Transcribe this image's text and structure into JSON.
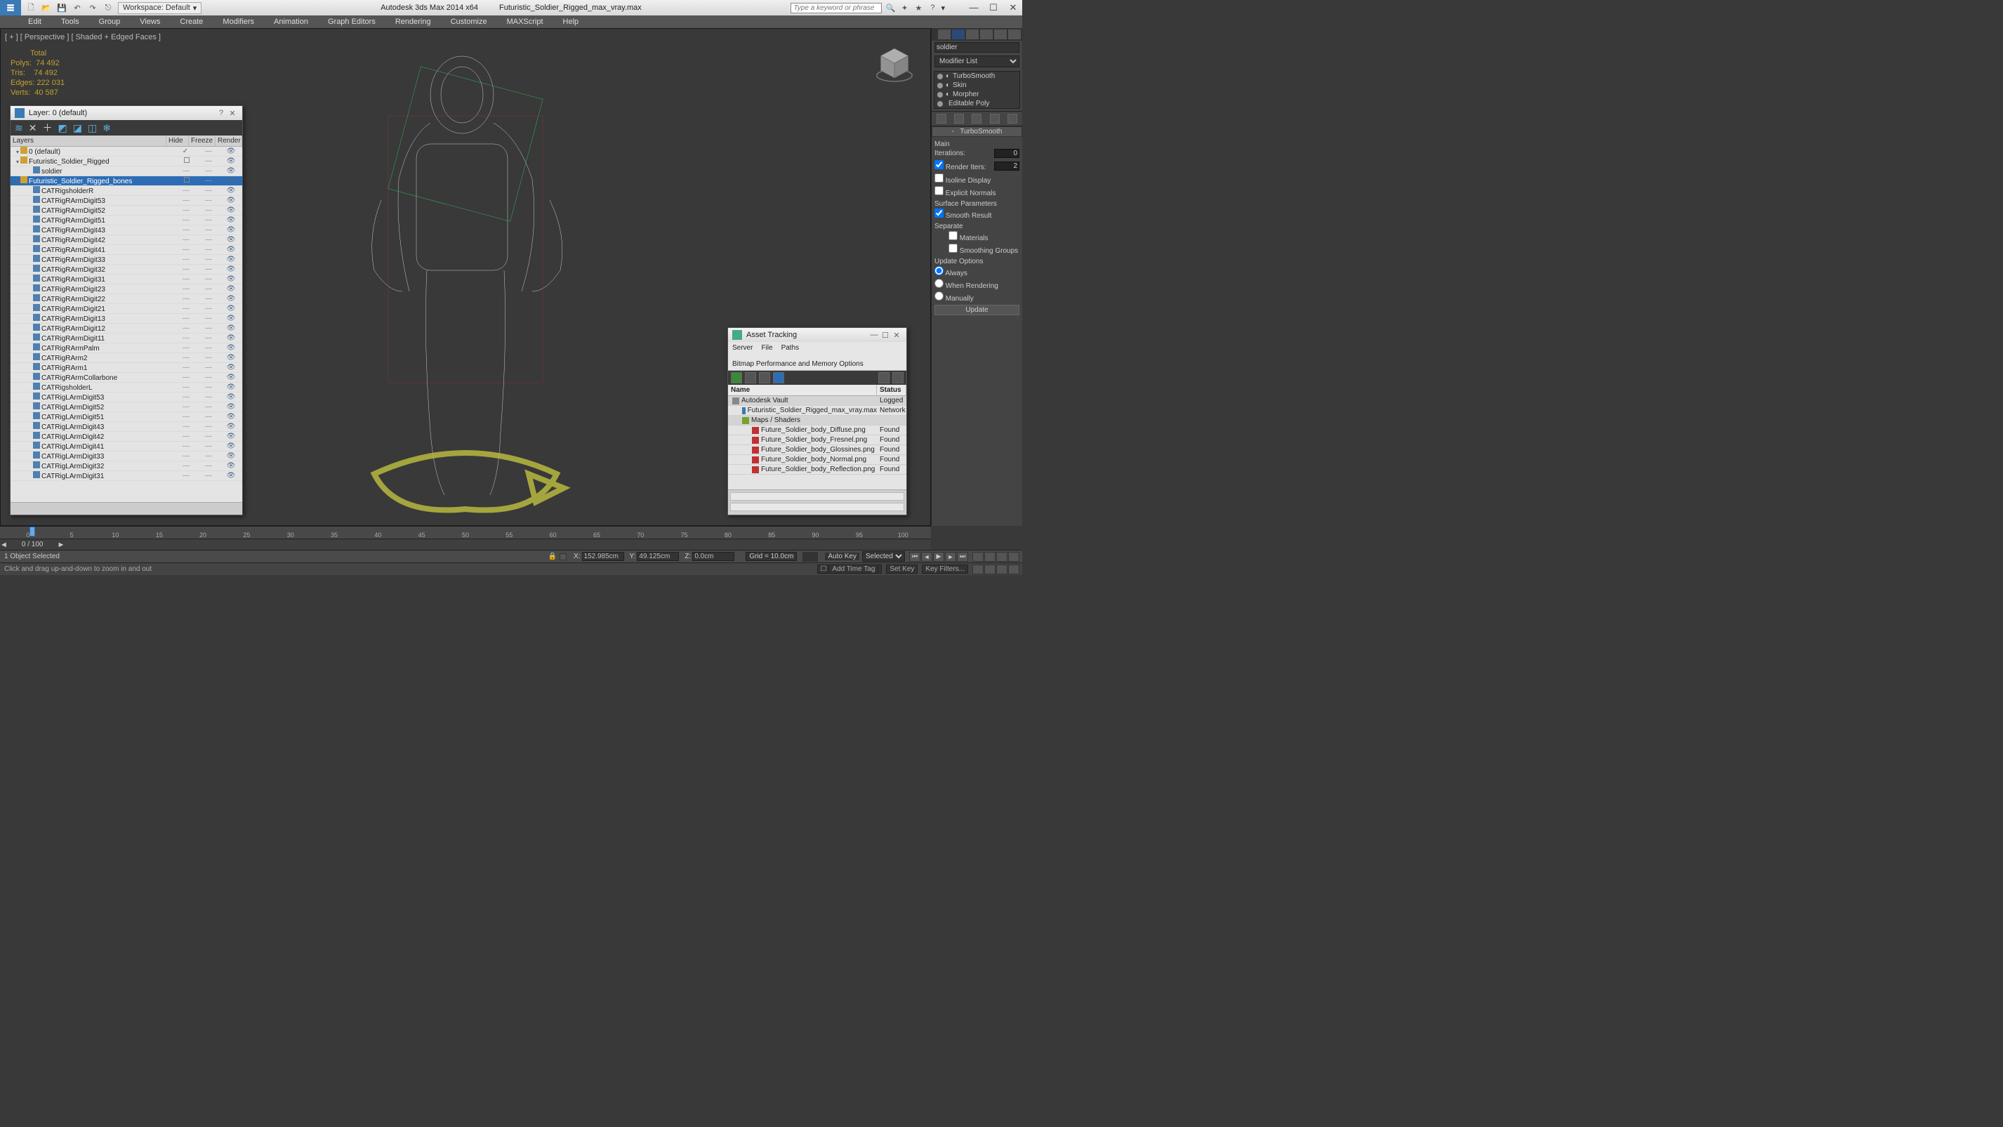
{
  "titlebar": {
    "workspace_label": "Workspace: Default",
    "app_title": "Autodesk 3ds Max  2014 x64",
    "file_title": "Futuristic_Soldier_Rigged_max_vray.max",
    "search_placeholder": "Type a keyword or phrase"
  },
  "mainmenu": [
    "Edit",
    "Tools",
    "Group",
    "Views",
    "Create",
    "Modifiers",
    "Animation",
    "Graph Editors",
    "Rendering",
    "Customize",
    "MAXScript",
    "Help"
  ],
  "viewport": {
    "label": "[ + ] [ Perspective ] [ Shaded + Edged Faces ]",
    "stats": {
      "total_label": "Total",
      "polys_label": "Polys:",
      "polys": "74 492",
      "tris_label": "Tris:",
      "tris": "74 492",
      "edges_label": "Edges:",
      "edges": "222 031",
      "verts_label": "Verts:",
      "verts": "40 587"
    }
  },
  "modify_panel": {
    "object_name": "soldier",
    "modifier_list_label": "Modifier List",
    "stack": [
      "TurboSmooth",
      "Skin",
      "Morpher",
      "Editable Poly"
    ],
    "rollout_title": "TurboSmooth",
    "main_label": "Main",
    "iterations_label": "Iterations:",
    "iterations": "0",
    "render_iters_label": "Render Iters:",
    "render_iters": "2",
    "isoline_label": "Isoline Display",
    "explicit_normals_label": "Explicit Normals",
    "surf_params_label": "Surface Parameters",
    "smooth_result_label": "Smooth Result",
    "separate_label": "Separate",
    "materials_label": "Materials",
    "smoothing_groups_label": "Smoothing Groups",
    "update_options_label": "Update Options",
    "update_opts": [
      "Always",
      "When Rendering",
      "Manually"
    ],
    "update_btn": "Update"
  },
  "layer_dialog": {
    "title": "Layer: 0 (default)",
    "columns": [
      "Layers",
      "Hide",
      "Freeze",
      "Render"
    ],
    "rows": [
      {
        "name": "0 (default)",
        "indent": 0,
        "type": "layer",
        "check": true,
        "open": true
      },
      {
        "name": "Futuristic_Soldier_Rigged",
        "indent": 0,
        "type": "layer",
        "box": true,
        "open": true
      },
      {
        "name": "soldier",
        "indent": 2,
        "type": "obj"
      },
      {
        "name": "Futuristic_Soldier_Rigged_bones",
        "indent": 0,
        "type": "layer",
        "selected": true,
        "box": true,
        "open": true
      },
      {
        "name": "CATRigsholderR",
        "indent": 2,
        "type": "obj"
      },
      {
        "name": "CATRigRArmDigit53",
        "indent": 2,
        "type": "obj"
      },
      {
        "name": "CATRigRArmDigit52",
        "indent": 2,
        "type": "obj"
      },
      {
        "name": "CATRigRArmDigit51",
        "indent": 2,
        "type": "obj"
      },
      {
        "name": "CATRigRArmDigit43",
        "indent": 2,
        "type": "obj"
      },
      {
        "name": "CATRigRArmDigit42",
        "indent": 2,
        "type": "obj"
      },
      {
        "name": "CATRigRArmDigit41",
        "indent": 2,
        "type": "obj"
      },
      {
        "name": "CATRigRArmDigit33",
        "indent": 2,
        "type": "obj"
      },
      {
        "name": "CATRigRArmDigit32",
        "indent": 2,
        "type": "obj"
      },
      {
        "name": "CATRigRArmDigit31",
        "indent": 2,
        "type": "obj"
      },
      {
        "name": "CATRigRArmDigit23",
        "indent": 2,
        "type": "obj"
      },
      {
        "name": "CATRigRArmDigit22",
        "indent": 2,
        "type": "obj"
      },
      {
        "name": "CATRigRArmDigit21",
        "indent": 2,
        "type": "obj"
      },
      {
        "name": "CATRigRArmDigit13",
        "indent": 2,
        "type": "obj"
      },
      {
        "name": "CATRigRArmDigit12",
        "indent": 2,
        "type": "obj"
      },
      {
        "name": "CATRigRArmDigit11",
        "indent": 2,
        "type": "obj"
      },
      {
        "name": "CATRigRArmPalm",
        "indent": 2,
        "type": "obj"
      },
      {
        "name": "CATRigRArm2",
        "indent": 2,
        "type": "obj"
      },
      {
        "name": "CATRigRArm1",
        "indent": 2,
        "type": "obj"
      },
      {
        "name": "CATRigRArmCollarbone",
        "indent": 2,
        "type": "obj"
      },
      {
        "name": "CATRigsholderL",
        "indent": 2,
        "type": "obj"
      },
      {
        "name": "CATRigLArmDigit53",
        "indent": 2,
        "type": "obj"
      },
      {
        "name": "CATRigLArmDigit52",
        "indent": 2,
        "type": "obj"
      },
      {
        "name": "CATRigLArmDigit51",
        "indent": 2,
        "type": "obj"
      },
      {
        "name": "CATRigLArmDigit43",
        "indent": 2,
        "type": "obj"
      },
      {
        "name": "CATRigLArmDigit42",
        "indent": 2,
        "type": "obj"
      },
      {
        "name": "CATRigLArmDigit41",
        "indent": 2,
        "type": "obj"
      },
      {
        "name": "CATRigLArmDigit33",
        "indent": 2,
        "type": "obj"
      },
      {
        "name": "CATRigLArmDigit32",
        "indent": 2,
        "type": "obj"
      },
      {
        "name": "CATRigLArmDigit31",
        "indent": 2,
        "type": "obj"
      }
    ]
  },
  "asset_dialog": {
    "title": "Asset Tracking",
    "menu": [
      "Server",
      "File",
      "Paths",
      "Bitmap Performance and Memory Options"
    ],
    "columns": {
      "name": "Name",
      "status": "Status"
    },
    "rows": [
      {
        "name": "Autodesk Vault",
        "status": "Logged",
        "cat": true,
        "indent": 0,
        "icon": "cloud"
      },
      {
        "name": "Futuristic_Soldier_Rigged_max_vray.max",
        "status": "Network",
        "indent": 1,
        "icon": "file"
      },
      {
        "name": "Maps / Shaders",
        "status": "",
        "cat": true,
        "indent": 1,
        "icon": "folder"
      },
      {
        "name": "Future_Soldier_body_Diffuse.png",
        "status": "Found",
        "indent": 2,
        "icon": "png"
      },
      {
        "name": "Future_Soldier_body_Fresnel.png",
        "status": "Found",
        "indent": 2,
        "icon": "png"
      },
      {
        "name": "Future_Soldier_body_Glossines.png",
        "status": "Found",
        "indent": 2,
        "icon": "png"
      },
      {
        "name": "Future_Soldier_body_Normal.png",
        "status": "Found",
        "indent": 2,
        "icon": "png"
      },
      {
        "name": "Future_Soldier_body_Reflection.png",
        "status": "Found",
        "indent": 2,
        "icon": "png"
      }
    ]
  },
  "timeline": {
    "frame_label": "0 / 100",
    "ticks": [
      0,
      5,
      10,
      15,
      20,
      25,
      30,
      35,
      40,
      45,
      50,
      55,
      60,
      65,
      70,
      75,
      80,
      85,
      90,
      95,
      100
    ]
  },
  "status": {
    "sel_text": "1 Object Selected",
    "x_label": "X:",
    "x": "152.985cm",
    "y_label": "Y:",
    "y": "49.125cm",
    "z_label": "Z:",
    "z": "0.0cm",
    "grid_label": "Grid = 10.0cm",
    "autokey_label": "Auto Key",
    "setkey_label": "Set Key",
    "keymode_selected": "Selected",
    "addtimetag": "Add Time Tag",
    "keyfilters": "Key Filters...",
    "hint": "Click and drag up-and-down to zoom in and out"
  }
}
